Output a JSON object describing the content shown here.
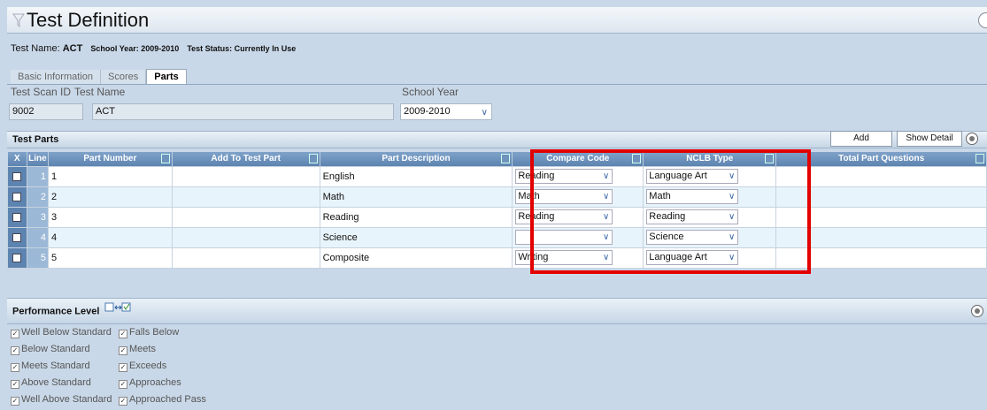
{
  "header": {
    "title": "Test Definition"
  },
  "summary": {
    "test_name_label": "Test Name:",
    "test_name_value": "ACT",
    "school_year_text": "School Year: 2009-2010",
    "test_status_text": "Test Status: Currently In Use"
  },
  "tabs": [
    {
      "label": "Basic Information",
      "active": false
    },
    {
      "label": "Scores",
      "active": false
    },
    {
      "label": "Parts",
      "active": true
    }
  ],
  "fields": {
    "scan_id_label": "Test Scan ID",
    "scan_id_value": "9002",
    "test_name_label": "Test Name",
    "test_name_value": "ACT",
    "school_year_label": "School Year",
    "school_year_value": "2009-2010"
  },
  "test_parts": {
    "section_title": "Test Parts",
    "add_label": "Add",
    "show_detail_label": "Show Detail",
    "columns": [
      "X",
      "Line",
      "Part Number",
      "Add To Test Part",
      "Part Description",
      "Compare Code",
      "NCLB Type",
      "Total Part Questions"
    ],
    "rows": [
      {
        "line": "1",
        "part_number": "1",
        "add_to": "",
        "description": "English",
        "compare_code": "Reading",
        "nclb_type": "Language Art"
      },
      {
        "line": "2",
        "part_number": "2",
        "add_to": "",
        "description": "Math",
        "compare_code": "Math",
        "nclb_type": "Math"
      },
      {
        "line": "3",
        "part_number": "3",
        "add_to": "",
        "description": "Reading",
        "compare_code": "Reading",
        "nclb_type": "Reading"
      },
      {
        "line": "4",
        "part_number": "4",
        "add_to": "",
        "description": "Science",
        "compare_code": "",
        "nclb_type": "Science"
      },
      {
        "line": "5",
        "part_number": "5",
        "add_to": "",
        "description": "Composite",
        "compare_code": "Writing",
        "nclb_type": "Language Art"
      }
    ]
  },
  "performance": {
    "section_title": "Performance Level",
    "left": [
      "Well Below Standard",
      "Below Standard",
      "Meets Standard",
      "Above Standard",
      "Well Above Standard"
    ],
    "right": [
      "Falls Below",
      "Meets",
      "Exceeds",
      "Approaches",
      "Approached Pass"
    ]
  },
  "colors": {
    "highlight": "#e30000",
    "header_blue": "#5d84b0"
  }
}
